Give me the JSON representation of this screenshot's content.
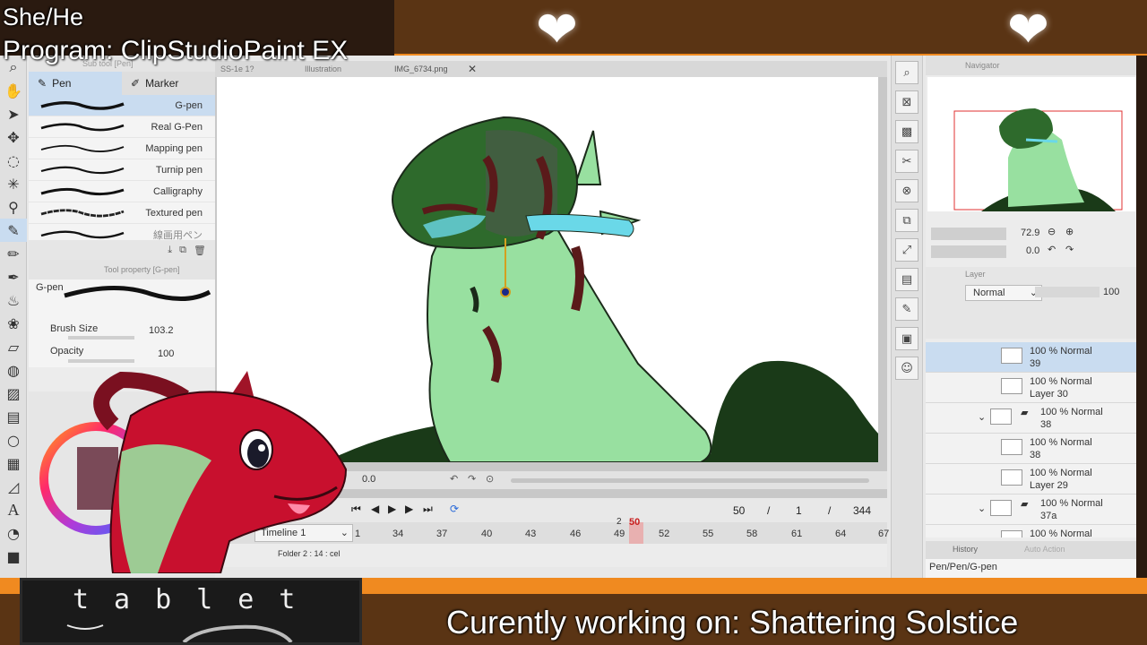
{
  "overlay": {
    "pronouns": "She/He",
    "program": "Program: ClipStudioPaint EX",
    "working_on": "Curently working on: Shattering Solstice",
    "tablet_label": "tablet",
    "heart_glyph": "❤"
  },
  "app": {
    "subtool_panel_title": "Sub tool [Pen]",
    "tabs": [
      {
        "label": "Pen",
        "icon": "pen-icon"
      },
      {
        "label": "Marker",
        "icon": "marker-icon"
      }
    ],
    "brushes": [
      "G-pen",
      "Real G-Pen",
      "Mapping pen",
      "Turnip pen",
      "Calligraphy",
      "Textured pen",
      "線画用ペン"
    ],
    "tool_property_title": "Tool property [G-pen]",
    "tool_property_name": "G-pen",
    "brush_size_label": "Brush Size",
    "brush_size_value": "103.2",
    "opacity_label": "Opacity",
    "opacity_value": "100",
    "doc_tabs": [
      "SS-1e 1?",
      "Illustration",
      "IMG_6734.png"
    ],
    "close_glyph": "✕",
    "canvas_rotation": "0.0",
    "timeline": {
      "name": "Timeline 1",
      "current_frame": "50",
      "slash1": "/",
      "frame_a": "1",
      "slash2": "/",
      "total": "344",
      "frames": [
        "1",
        "34",
        "37",
        "40",
        "43",
        "46",
        "49",
        "52",
        "55",
        "58",
        "61",
        "64",
        "67"
      ],
      "marker_a": "2",
      "marker_b": "50",
      "track_label": "Folder 2 : 14 : cel"
    },
    "navigator_title": "Navigator",
    "zoom": "72.9",
    "rotation": "0.0",
    "layer_title": "Layer",
    "blend_mode": "Normal",
    "layer_opacity": "100",
    "layers": [
      {
        "pct": "100 % Normal",
        "name": "39",
        "active": true,
        "folder": false,
        "indent": 0
      },
      {
        "pct": "100 % Normal",
        "name": "Layer 30",
        "active": false,
        "folder": false,
        "indent": 0
      },
      {
        "pct": "100 % Normal",
        "name": "38",
        "active": false,
        "folder": true,
        "indent": 0
      },
      {
        "pct": "100 % Normal",
        "name": "38",
        "active": false,
        "folder": false,
        "indent": 1
      },
      {
        "pct": "100 % Normal",
        "name": "Layer 29",
        "active": false,
        "folder": false,
        "indent": 1
      },
      {
        "pct": "100 % Normal",
        "name": "37a",
        "active": false,
        "folder": true,
        "indent": 0
      },
      {
        "pct": "100 % Normal",
        "name": "",
        "active": false,
        "folder": false,
        "indent": 1
      }
    ],
    "history_tab": "History",
    "auto_action_tab": "Auto Action",
    "history_entry": "Pen/Pen/G-pen"
  },
  "colors": {
    "frame_brown": "#5a3414",
    "frame_orange": "#f08a20",
    "selection_blue": "#c9dcf0",
    "dragon_green": "#98e0a0",
    "dragon_dark": "#1a3a18",
    "avatar_red": "#c8102e"
  }
}
